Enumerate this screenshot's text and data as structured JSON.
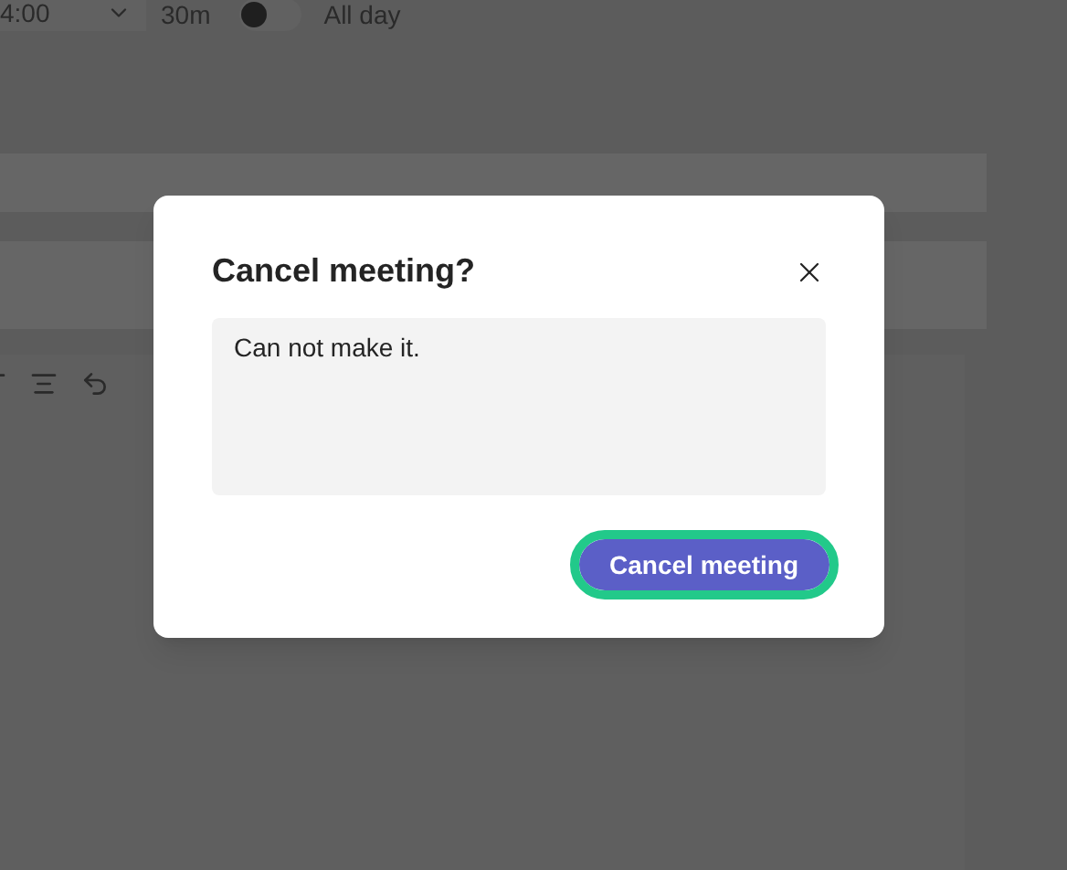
{
  "background": {
    "start_time": "4:00",
    "duration": "30m",
    "all_day": {
      "label": "All day",
      "on": false
    }
  },
  "dialog": {
    "title": "Cancel meeting?",
    "message": {
      "value": "Can not make it."
    },
    "confirm_button": {
      "label": "Cancel meeting",
      "focused": true
    }
  }
}
